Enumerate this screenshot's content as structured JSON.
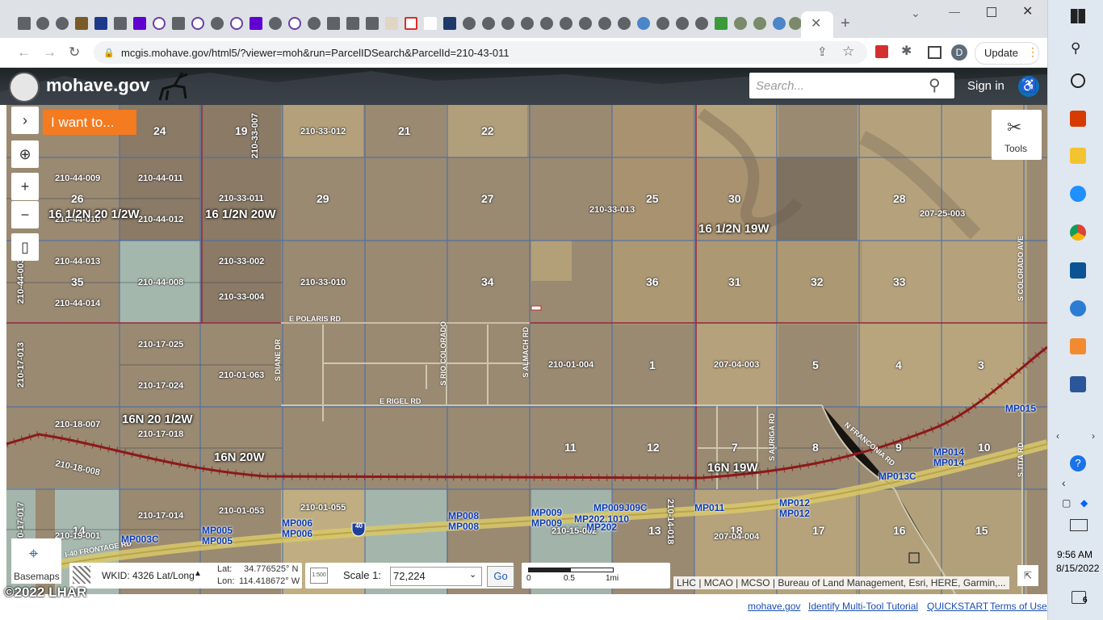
{
  "browser": {
    "url": "mcgis.mohave.gov/html5/?viewer=moh&run=ParcelIDSearch&ParcelId=210-43-011",
    "update_label": "Update",
    "profile_initial": "D"
  },
  "site": {
    "title": "mohave.gov",
    "search_placeholder": "Search...",
    "signin_label": "Sign in"
  },
  "map": {
    "i_want_to": "I want to...",
    "tools_label": "Tools",
    "basemaps_label": "Basemaps",
    "wkid_label": "WKID: 4326 Lat/Long",
    "lat_label": "Lat:",
    "lat_value": "34.776525° N",
    "lon_label": "Lon:",
    "lon_value": "114.418672° W",
    "scale_label": "Scale 1:",
    "scale_value": "72,224",
    "go_label": "Go",
    "scalebar_ticks": [
      "0",
      "0.5",
      "1mi"
    ],
    "attribution": "LHC | MCAO | MCSO | Bureau of Land Management, Esri, HERE, Garmin,...",
    "copyright": "©2022 LHAR",
    "sections": [
      "24",
      "19",
      "21",
      "22",
      "26",
      "29",
      "27",
      "25",
      "30",
      "28",
      "35",
      "34",
      "36",
      "31",
      "32",
      "33",
      "1",
      "5",
      "4",
      "3",
      "11",
      "12",
      "7",
      "8",
      "9",
      "10",
      "14",
      "13",
      "17",
      "16",
      "15",
      "18"
    ],
    "parcels": [
      "210-33-007",
      "210-33-012",
      "210-44-009",
      "210-44-011",
      "210-33-011",
      "210-33-013",
      "207-25-003",
      "210-44-010",
      "210-44-012",
      "210-44-013",
      "210-44-008",
      "210-33-002",
      "210-33-010",
      "210-44-014",
      "210-33-004",
      "210-44-003",
      "210-17-025",
      "210-17-013",
      "210-17-024",
      "210-01-063",
      "210-01-004",
      "207-04-003",
      "210-18-007",
      "210-17-018",
      "210-18-008",
      "210-17-014",
      "210-01-053",
      "210-01-055",
      "210-19-001",
      "210-15-002",
      "210-14-018",
      "207-04-004",
      "210-17-017"
    ],
    "townships": [
      "16 1/2N 20 1/2W",
      "16 1/2N 20W",
      "16 1/2N 19W",
      "16N 20 1/2W",
      "16N 20W",
      "16N 19W"
    ],
    "roads": [
      "E POLARIS RD",
      "S DIANE DR",
      "S RIO COLORADO",
      "S ALMACH RD",
      "E RIGEL RD",
      "S AURIGA RD",
      "N FRANCONIA RD",
      "S TITA RD",
      "S COLORADO AVE",
      "I-40 FRONTAGE RD"
    ],
    "mileposts": [
      "MP003C",
      "MP005",
      "MP005",
      "MP006",
      "MP006",
      "MP008",
      "MP008",
      "MP009",
      "MP009",
      "MP009J09C",
      "MP202.1010",
      "MP202",
      "MP011",
      "MP012",
      "MP012",
      "MP013C",
      "MP014",
      "MP014",
      "MP015"
    ],
    "interstate": "40"
  },
  "footer": {
    "links": [
      "mohave.gov",
      "Identify Multi-Tool Tutorial",
      "QUICKSTART",
      "Terms of Use"
    ]
  },
  "taskbar": {
    "time": "9:56 AM",
    "date": "8/15/2022",
    "notification_count": "6"
  },
  "colors": {
    "accent_orange": "#f47b20",
    "header_dark": "#2c3135",
    "link_blue": "#1a4db3",
    "railroad": "#8b1a1a"
  }
}
